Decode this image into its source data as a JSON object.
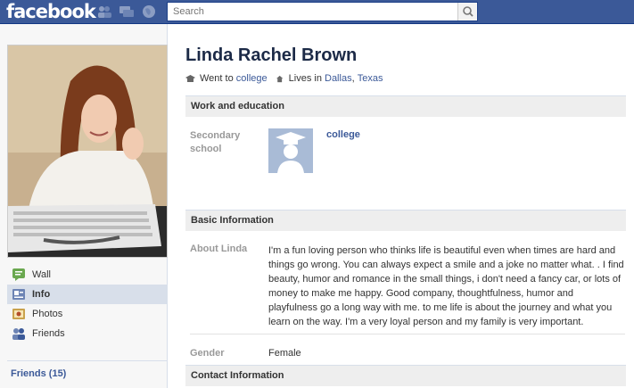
{
  "header": {
    "logo": "facebook",
    "search_placeholder": "Search"
  },
  "profile": {
    "name": "Linda Rachel Brown",
    "went_to_prefix": "Went to",
    "went_to_school": "college",
    "lives_in_prefix": "Lives in",
    "city": "Dallas",
    "separator": ",",
    "state": "Texas"
  },
  "sidebar": {
    "items": [
      {
        "label": "Wall",
        "icon": "wall-icon",
        "active": false
      },
      {
        "label": "Info",
        "icon": "info-icon",
        "active": true
      },
      {
        "label": "Photos",
        "icon": "photos-icon",
        "active": false
      },
      {
        "label": "Friends",
        "icon": "friends-icon",
        "active": false
      }
    ],
    "friends_link": "Friends (15)"
  },
  "work_education": {
    "heading": "Work and education",
    "label_line1": "Secondary",
    "label_line2": "school",
    "school": "college"
  },
  "basic_info": {
    "heading": "Basic Information",
    "about_label": "About Linda",
    "about_lines": [
      "I'm a fun loving person who thinks life is beautiful even when times are hard and",
      "things go wrong. You can always expect a smile and a joke no matter what. . I find",
      "beauty, humor and romance in the small things, i don't need a fancy car, or lots of",
      "money to make me happy. Good company, thoughtfulness, humor and",
      "playfulness go a long way with me. to me life is about the journey and what you",
      "learn on the way. I'm a very loyal person and my family is very important."
    ],
    "gender_label": "Gender",
    "gender": "Female"
  },
  "contact": {
    "heading": "Contact Information"
  },
  "colors": {
    "brand": "#3b5998",
    "nav_active": "#d8dfea",
    "section_bg": "#eeeeee"
  }
}
